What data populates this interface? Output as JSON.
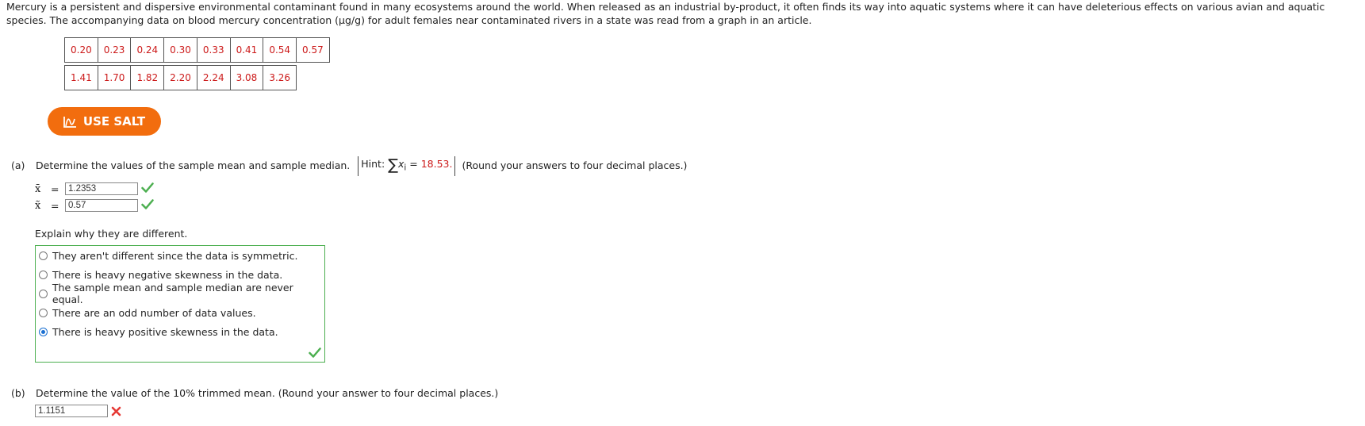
{
  "intro_text": "Mercury is a persistent and dispersive environmental contaminant found in many ecosystems around the world. When released as an industrial by-product, it often finds its way into aquatic systems where it can have deleterious effects on various avian and aquatic species. The accompanying data on blood mercury concentration (µg/g) for adult females near contaminated rivers in a state was read from a graph in an article.",
  "data_table": {
    "row1": [
      "0.20",
      "0.23",
      "0.24",
      "0.30",
      "0.33",
      "0.41",
      "0.54",
      "0.57"
    ],
    "row2": [
      "1.41",
      "1.70",
      "1.82",
      "2.20",
      "2.24",
      "3.08",
      "3.26"
    ]
  },
  "salt_button": {
    "label": "USE SALT",
    "icon": "salt-chart-icon",
    "color": "#f26d0e"
  },
  "part_a": {
    "label": "(a)",
    "question": "Determine the values of the sample mean and sample median.",
    "hint_prefix": "Hint:",
    "hint_symbol": "∑",
    "hint_var": "x",
    "hint_sub": "i",
    "hint_eq": " = ",
    "hint_value": "18.53.",
    "round_note": "(Round your answers to four decimal places.)",
    "mean_symbol": "x̄",
    "median_symbol": "x̃",
    "equals": "=",
    "mean_value": "1.2353",
    "median_value": "0.57",
    "explain_prompt": "Explain why they are different.",
    "options": [
      "They aren't different since the data is symmetric.",
      "There is heavy negative skewness in the data.",
      "The sample mean and sample median are never equal.",
      "There are an odd number of data values.",
      "There is heavy positive skewness in the data."
    ],
    "selected_option_index": 4
  },
  "part_b": {
    "label": "(b)",
    "question": "Determine the value of the 10% trimmed mean. (Round your answer to four decimal places.)",
    "answer_value": "1.1151"
  },
  "colors": {
    "correct": "#4caf50",
    "incorrect": "#e53935",
    "data_text": "#cc1a1a"
  }
}
